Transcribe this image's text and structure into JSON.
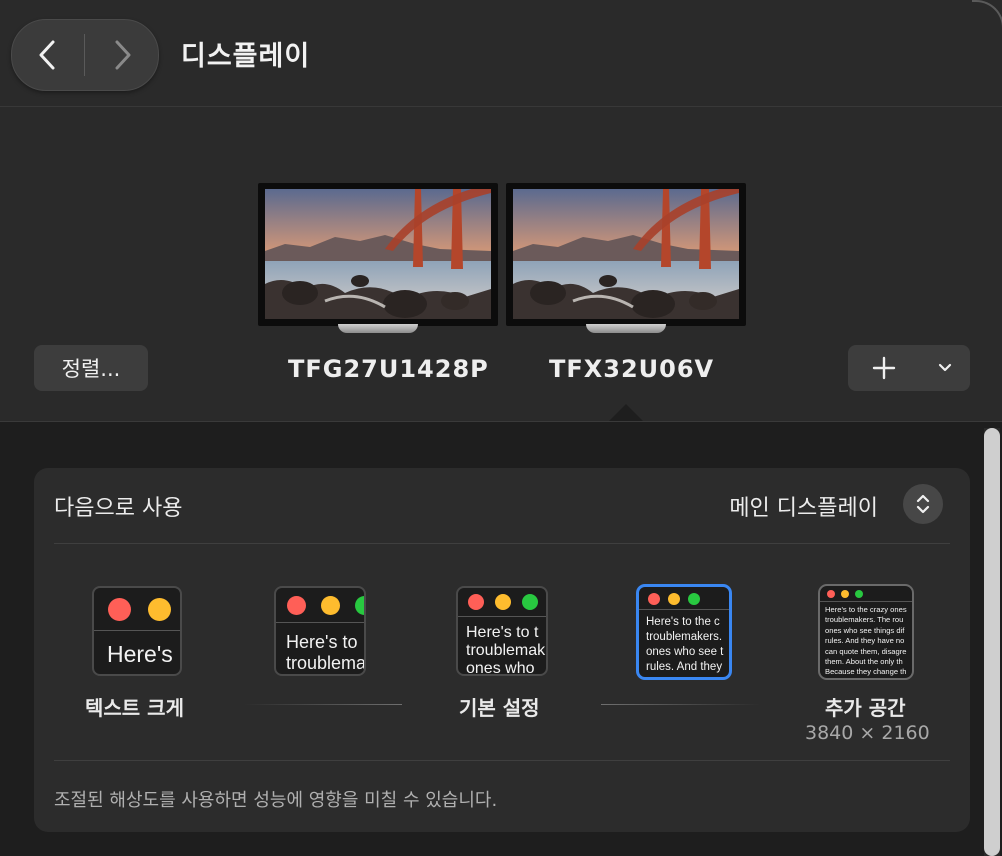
{
  "header": {
    "title": "디스플레이"
  },
  "displays": [
    {
      "name": "TFG27U1428P"
    },
    {
      "name": "TFX32U06V"
    }
  ],
  "arrange_button": {
    "label": "정렬..."
  },
  "add_button": {
    "icon": "plus-icon"
  },
  "settings": {
    "use_as": {
      "label": "다음으로 사용",
      "value": "메인 디스플레이"
    },
    "resolution_options": [
      {
        "label": "텍스트 크게",
        "preview": "Here's",
        "selected": false
      },
      {
        "preview": "Here's to\ntroublema",
        "selected": false
      },
      {
        "label": "기본 설정",
        "preview": "Here's to t\ntroublemak\nones who",
        "selected": false
      },
      {
        "preview": "Here's to the c\ntroublemakers.\nones who see t\nrules. And they",
        "selected": true
      },
      {
        "label": "추가 공간",
        "sub": "3840 × 2160",
        "preview": "Here's to the crazy ones\ntroublemakers. The rou\nones who see things dif\nrules. And they have no\ncan quote them, disagre\nthem. About the only th\nBecause they change th",
        "selected": false
      }
    ],
    "footnote": "조절된 해상도를 사용하면 성능에 영향을 미칠 수 있습니다."
  },
  "colors": {
    "accent": "#3a87f2",
    "window_bg": "#1e1e1e",
    "panel_bg": "#2a2a2a",
    "card_bg": "#2c2c2c"
  }
}
